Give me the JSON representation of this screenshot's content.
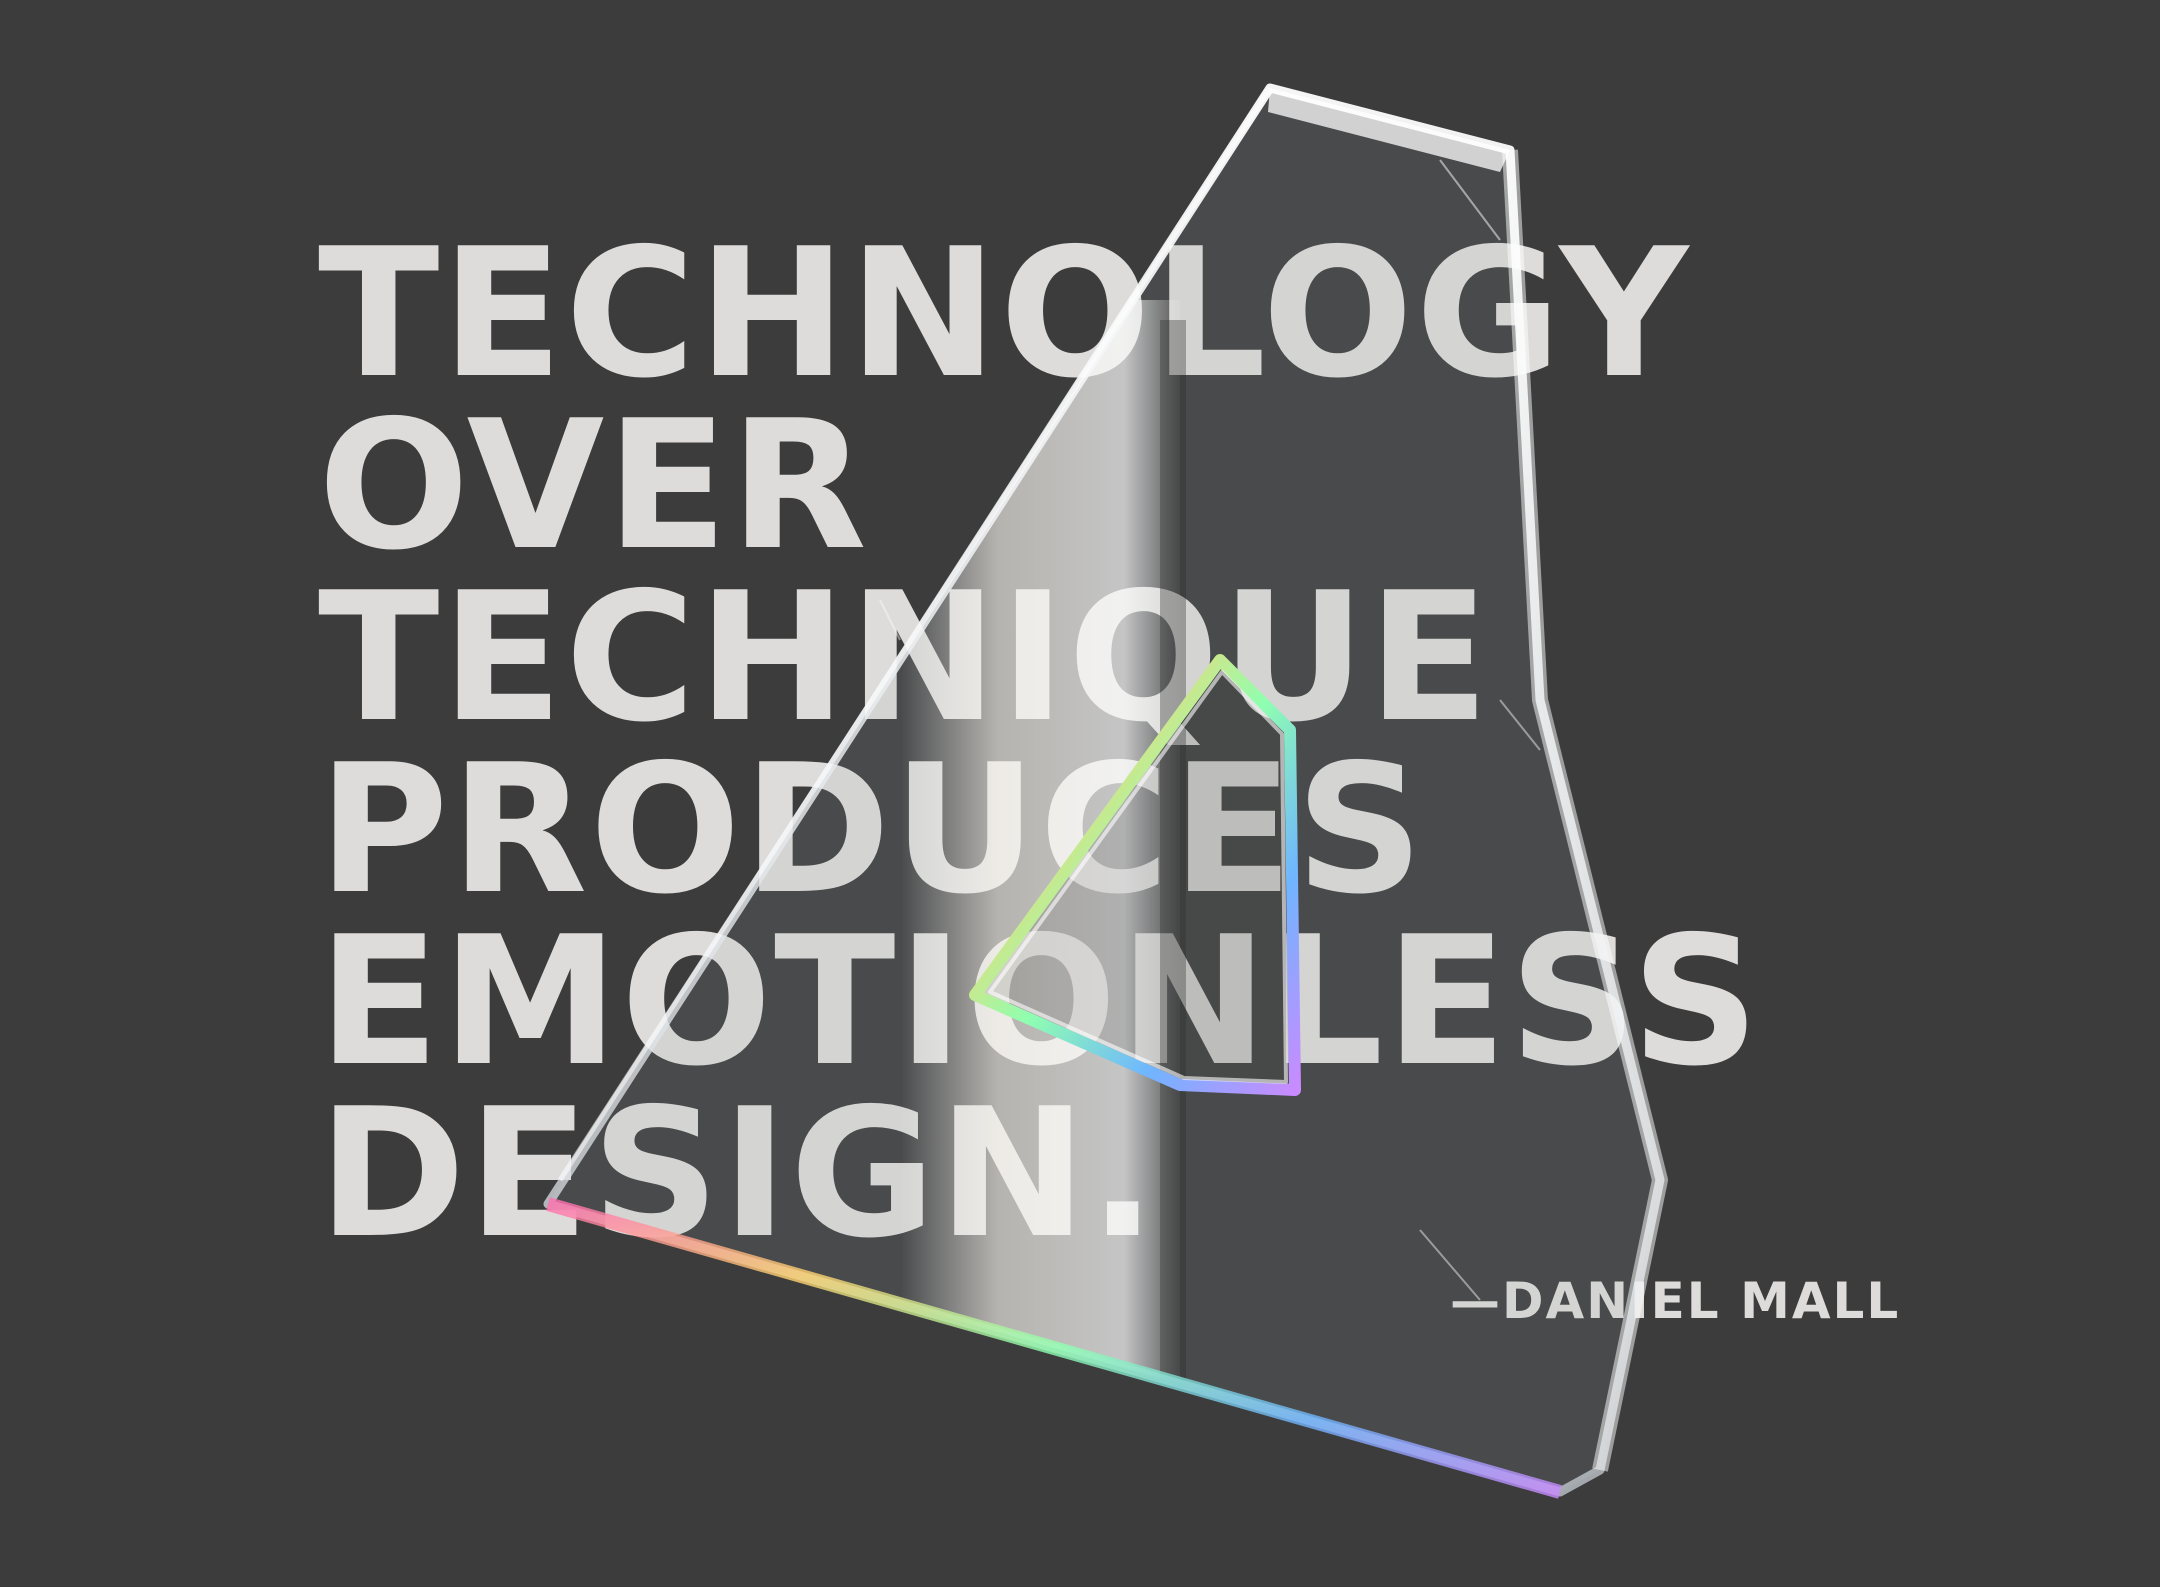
{
  "quote": {
    "lines": [
      "TECHNOLOGY",
      "OVER",
      "TECHNIQUE",
      "PRODUCES",
      "EMOTIONLESS",
      "DESIGN."
    ]
  },
  "attribution": "—DANIEL MALL",
  "colors": {
    "background": "#3c3c3c",
    "text": "#dedcda"
  }
}
